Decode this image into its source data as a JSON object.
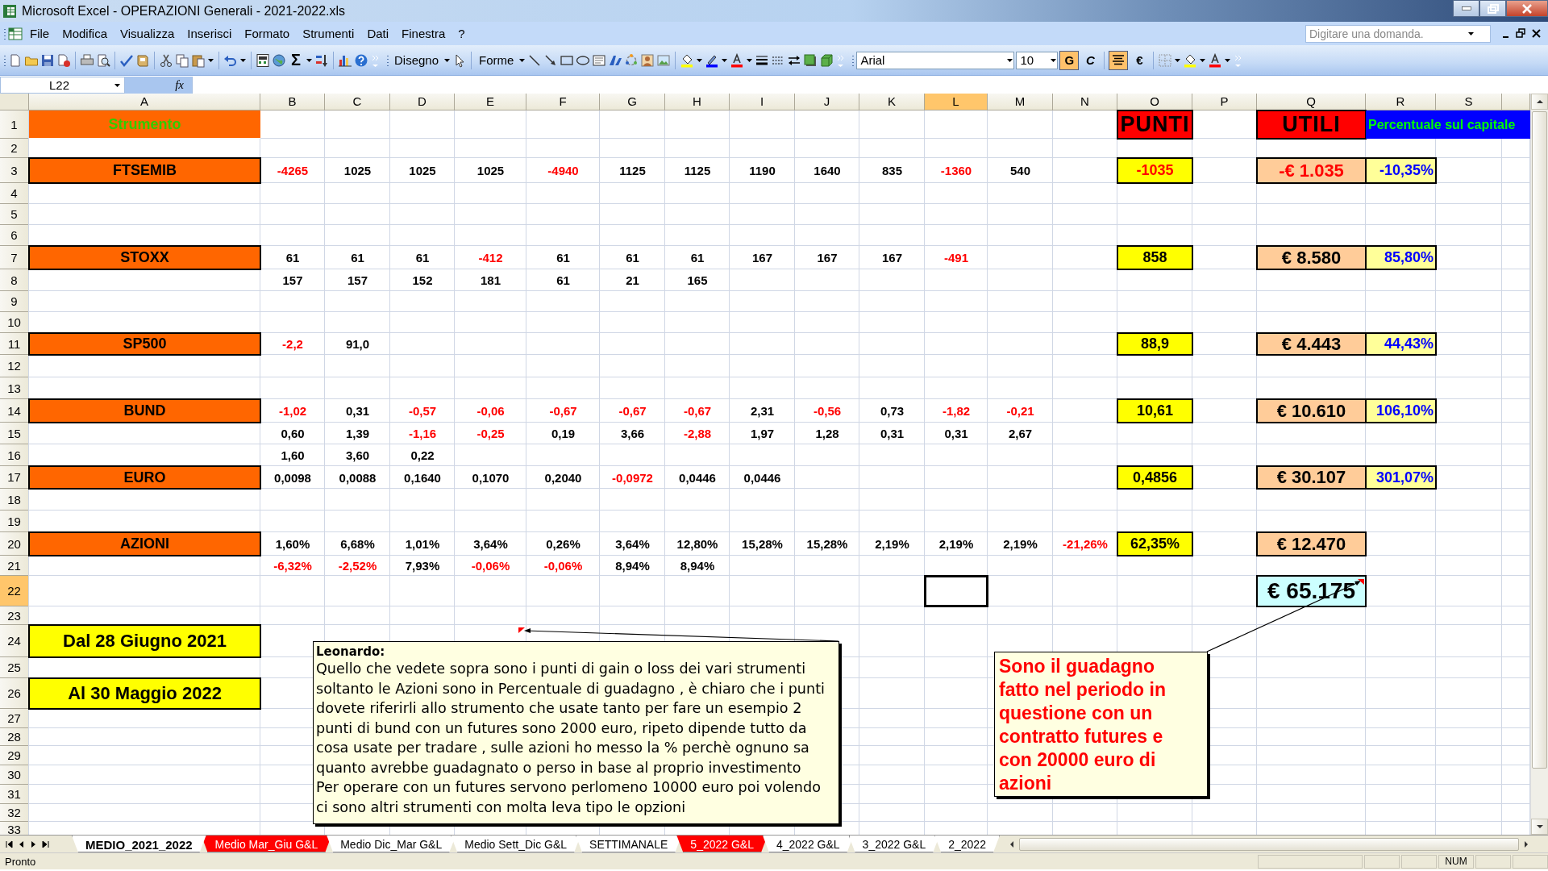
{
  "window": {
    "title": "Microsoft Excel - OPERAZIONI Generali - 2021-2022.xls"
  },
  "menu": [
    {
      "label": "File"
    },
    {
      "label": "Modifica"
    },
    {
      "label": "Visualizza"
    },
    {
      "label": "Inserisci"
    },
    {
      "label": "Formato"
    },
    {
      "label": "Strumenti"
    },
    {
      "label": "Dati"
    },
    {
      "label": "Finestra"
    },
    {
      "label": "?"
    }
  ],
  "help_field": {
    "placeholder": "Digitare una domanda."
  },
  "toolbar": {
    "sum": "Σ",
    "draw_menu": "Disegno",
    "shapes_menu": "Forme",
    "font": "Arial",
    "size": "10",
    "bold": "G",
    "bold_on": true,
    "italic": "C",
    "italic_on": false,
    "center_on": true,
    "euro": "€"
  },
  "formula_bar": {
    "name_box": "L22",
    "fx": "fx"
  },
  "columns": [
    {
      "label": "A",
      "selected": false
    },
    {
      "label": "B",
      "selected": false
    },
    {
      "label": "C",
      "selected": false
    },
    {
      "label": "D",
      "selected": false
    },
    {
      "label": "E",
      "selected": false
    },
    {
      "label": "F",
      "selected": false
    },
    {
      "label": "G",
      "selected": false
    },
    {
      "label": "H",
      "selected": false
    },
    {
      "label": "I",
      "selected": false
    },
    {
      "label": "J",
      "selected": false
    },
    {
      "label": "K",
      "selected": false
    },
    {
      "label": "L",
      "selected": true
    },
    {
      "label": "M",
      "selected": false
    },
    {
      "label": "N",
      "selected": false
    },
    {
      "label": "O",
      "selected": false
    },
    {
      "label": "P",
      "selected": false
    },
    {
      "label": "Q",
      "selected": false
    },
    {
      "label": "R",
      "selected": false
    },
    {
      "label": "S",
      "selected": false
    }
  ],
  "rows": [
    {
      "header": "1",
      "selected": false,
      "cells": {
        "A": {
          "kind": "title",
          "text": "Strumento",
          "negative": false
        },
        "O": {
          "kind": "heading",
          "text": "PUNTI",
          "negative": false
        },
        "Q": {
          "kind": "heading",
          "text": "UTILI",
          "negative": false
        },
        "R": {
          "kind": "banner",
          "text": "Percentuale sul capitale",
          "negative": false
        }
      }
    },
    {
      "header": "2",
      "selected": false,
      "cells": {}
    },
    {
      "header": "3",
      "selected": false,
      "cells": {
        "A": {
          "kind": "label",
          "text": "FTSEMIB",
          "negative": false
        },
        "B": {
          "kind": "value",
          "text": "-4265",
          "negative": true
        },
        "C": {
          "kind": "value",
          "text": "1025",
          "negative": false
        },
        "D": {
          "kind": "value",
          "text": "1025",
          "negative": false
        },
        "E": {
          "kind": "value",
          "text": "1025",
          "negative": false
        },
        "F": {
          "kind": "value",
          "text": "-4940",
          "negative": true
        },
        "G": {
          "kind": "value",
          "text": "1125",
          "negative": false
        },
        "H": {
          "kind": "value",
          "text": "1125",
          "negative": false
        },
        "I": {
          "kind": "value",
          "text": "1190",
          "negative": false
        },
        "J": {
          "kind": "value",
          "text": "1640",
          "negative": false
        },
        "K": {
          "kind": "value",
          "text": "835",
          "negative": false
        },
        "L": {
          "kind": "value",
          "text": "-1360",
          "negative": true
        },
        "M": {
          "kind": "value",
          "text": "540",
          "negative": false
        },
        "O": {
          "kind": "points",
          "text": "-1035",
          "negative": true
        },
        "Q": {
          "kind": "profit",
          "text": "-€ 1.035",
          "negative": true
        },
        "R": {
          "kind": "percent",
          "text": "-10,35%",
          "negative": false
        }
      }
    },
    {
      "header": "4",
      "selected": false,
      "cells": {}
    },
    {
      "header": "5",
      "selected": false,
      "cells": {}
    },
    {
      "header": "6",
      "selected": false,
      "cells": {}
    },
    {
      "header": "7",
      "selected": false,
      "cells": {
        "A": {
          "kind": "label",
          "text": "STOXX",
          "negative": false
        },
        "B": {
          "kind": "value",
          "text": "61",
          "negative": false
        },
        "C": {
          "kind": "value",
          "text": "61",
          "negative": false
        },
        "D": {
          "kind": "value",
          "text": "61",
          "negative": false
        },
        "E": {
          "kind": "value",
          "text": "-412",
          "negative": true
        },
        "F": {
          "kind": "value",
          "text": "61",
          "negative": false
        },
        "G": {
          "kind": "value",
          "text": "61",
          "negative": false
        },
        "H": {
          "kind": "value",
          "text": "61",
          "negative": false
        },
        "I": {
          "kind": "value",
          "text": "167",
          "negative": false
        },
        "J": {
          "kind": "value",
          "text": "167",
          "negative": false
        },
        "K": {
          "kind": "value",
          "text": "167",
          "negative": false
        },
        "L": {
          "kind": "value",
          "text": "-491",
          "negative": true
        },
        "O": {
          "kind": "points",
          "text": "858",
          "negative": false
        },
        "Q": {
          "kind": "profit",
          "text": "€ 8.580",
          "negative": false
        },
        "R": {
          "kind": "percent",
          "text": "85,80%",
          "negative": false
        }
      }
    },
    {
      "header": "8",
      "selected": false,
      "cells": {
        "B": {
          "kind": "value",
          "text": "157",
          "negative": false
        },
        "C": {
          "kind": "value",
          "text": "157",
          "negative": false
        },
        "D": {
          "kind": "value",
          "text": "152",
          "negative": false
        },
        "E": {
          "kind": "value",
          "text": "181",
          "negative": false
        },
        "F": {
          "kind": "value",
          "text": "61",
          "negative": false
        },
        "G": {
          "kind": "value",
          "text": "21",
          "negative": false
        },
        "H": {
          "kind": "value",
          "text": "165",
          "negative": false
        }
      }
    },
    {
      "header": "9",
      "selected": false,
      "cells": {}
    },
    {
      "header": "10",
      "selected": false,
      "cells": {}
    },
    {
      "header": "11",
      "selected": false,
      "cells": {
        "A": {
          "kind": "label",
          "text": "SP500",
          "negative": false
        },
        "B": {
          "kind": "value",
          "text": "-2,2",
          "negative": true
        },
        "C": {
          "kind": "value",
          "text": "91,0",
          "negative": false
        },
        "O": {
          "kind": "points",
          "text": "88,9",
          "negative": false
        },
        "Q": {
          "kind": "profit",
          "text": "€ 4.443",
          "negative": false
        },
        "R": {
          "kind": "percent",
          "text": "44,43%",
          "negative": false
        }
      }
    },
    {
      "header": "12",
      "selected": false,
      "cells": {}
    },
    {
      "header": "13",
      "selected": false,
      "cells": {}
    },
    {
      "header": "14",
      "selected": false,
      "cells": {
        "A": {
          "kind": "label",
          "text": "BUND",
          "negative": false
        },
        "B": {
          "kind": "value",
          "text": "-1,02",
          "negative": true
        },
        "C": {
          "kind": "value",
          "text": "0,31",
          "negative": false
        },
        "D": {
          "kind": "value",
          "text": "-0,57",
          "negative": true
        },
        "E": {
          "kind": "value",
          "text": "-0,06",
          "negative": true
        },
        "F": {
          "kind": "value",
          "text": "-0,67",
          "negative": true
        },
        "G": {
          "kind": "value",
          "text": "-0,67",
          "negative": true
        },
        "H": {
          "kind": "value",
          "text": "-0,67",
          "negative": true
        },
        "I": {
          "kind": "value",
          "text": "2,31",
          "negative": false
        },
        "J": {
          "kind": "value",
          "text": "-0,56",
          "negative": true
        },
        "K": {
          "kind": "value",
          "text": "0,73",
          "negative": false
        },
        "L": {
          "kind": "value",
          "text": "-1,82",
          "negative": true
        },
        "M": {
          "kind": "value",
          "text": "-0,21",
          "negative": true
        },
        "O": {
          "kind": "points",
          "text": "10,61",
          "negative": false
        },
        "Q": {
          "kind": "profit",
          "text": "€ 10.610",
          "negative": false
        },
        "R": {
          "kind": "percent",
          "text": "106,10%",
          "negative": false
        }
      }
    },
    {
      "header": "15",
      "selected": false,
      "cells": {
        "B": {
          "kind": "value",
          "text": "0,60",
          "negative": false
        },
        "C": {
          "kind": "value",
          "text": "1,39",
          "negative": false
        },
        "D": {
          "kind": "value",
          "text": "-1,16",
          "negative": true
        },
        "E": {
          "kind": "value",
          "text": "-0,25",
          "negative": true
        },
        "F": {
          "kind": "value",
          "text": "0,19",
          "negative": false
        },
        "G": {
          "kind": "value",
          "text": "3,66",
          "negative": false
        },
        "H": {
          "kind": "value",
          "text": "-2,88",
          "negative": true
        },
        "I": {
          "kind": "value",
          "text": "1,97",
          "negative": false
        },
        "J": {
          "kind": "value",
          "text": "1,28",
          "negative": false
        },
        "K": {
          "kind": "value",
          "text": "0,31",
          "negative": false
        },
        "L": {
          "kind": "value",
          "text": "0,31",
          "negative": false
        },
        "M": {
          "kind": "value",
          "text": "2,67",
          "negative": false
        }
      }
    },
    {
      "header": "16",
      "selected": false,
      "cells": {
        "B": {
          "kind": "value",
          "text": "1,60",
          "negative": false
        },
        "C": {
          "kind": "value",
          "text": "3,60",
          "negative": false
        },
        "D": {
          "kind": "value",
          "text": "0,22",
          "negative": false
        }
      }
    },
    {
      "header": "17",
      "selected": false,
      "cells": {
        "A": {
          "kind": "label",
          "text": "EURO",
          "negative": false
        },
        "B": {
          "kind": "value",
          "text": "0,0098",
          "negative": false
        },
        "C": {
          "kind": "value",
          "text": "0,0088",
          "negative": false
        },
        "D": {
          "kind": "value",
          "text": "0,1640",
          "negative": false
        },
        "E": {
          "kind": "value",
          "text": "0,1070",
          "negative": false
        },
        "F": {
          "kind": "value",
          "text": "0,2040",
          "negative": false
        },
        "G": {
          "kind": "value",
          "text": "-0,0972",
          "negative": true
        },
        "H": {
          "kind": "value",
          "text": "0,0446",
          "negative": false
        },
        "I": {
          "kind": "value",
          "text": "0,0446",
          "negative": false
        },
        "O": {
          "kind": "points",
          "text": "0,4856",
          "negative": false
        },
        "Q": {
          "kind": "profit",
          "text": "€ 30.107",
          "negative": false
        },
        "R": {
          "kind": "percent",
          "text": "301,07%",
          "negative": false
        }
      }
    },
    {
      "header": "18",
      "selected": false,
      "cells": {}
    },
    {
      "header": "19",
      "selected": false,
      "cells": {}
    },
    {
      "header": "20",
      "selected": false,
      "cells": {
        "A": {
          "kind": "label",
          "text": "AZIONI",
          "negative": false
        },
        "B": {
          "kind": "value",
          "text": "1,60%",
          "negative": false
        },
        "C": {
          "kind": "value",
          "text": "6,68%",
          "negative": false
        },
        "D": {
          "kind": "value",
          "text": "1,01%",
          "negative": false
        },
        "E": {
          "kind": "value",
          "text": "3,64%",
          "negative": false
        },
        "F": {
          "kind": "value",
          "text": "0,26%",
          "negative": false
        },
        "G": {
          "kind": "value",
          "text": "3,64%",
          "negative": false
        },
        "H": {
          "kind": "value",
          "text": "12,80%",
          "negative": false
        },
        "I": {
          "kind": "value",
          "text": "15,28%",
          "negative": false
        },
        "J": {
          "kind": "value",
          "text": "15,28%",
          "negative": false
        },
        "K": {
          "kind": "value",
          "text": "2,19%",
          "negative": false
        },
        "L": {
          "kind": "value",
          "text": "2,19%",
          "negative": false
        },
        "M": {
          "kind": "value",
          "text": "2,19%",
          "negative": false
        },
        "N": {
          "kind": "value",
          "text": "-21,26%",
          "negative": true
        },
        "O": {
          "kind": "points",
          "text": "62,35%",
          "negative": false
        },
        "Q": {
          "kind": "profit",
          "text": "€ 12.470",
          "negative": false
        }
      }
    },
    {
      "header": "21",
      "selected": false,
      "cells": {
        "B": {
          "kind": "value",
          "text": "-6,32%",
          "negative": true
        },
        "C": {
          "kind": "value",
          "text": "-2,52%",
          "negative": true
        },
        "D": {
          "kind": "value",
          "text": "7,93%",
          "negative": false
        },
        "E": {
          "kind": "value",
          "text": "-0,06%",
          "negative": true
        },
        "F": {
          "kind": "value",
          "text": "-0,06%",
          "negative": true
        },
        "G": {
          "kind": "value",
          "text": "8,94%",
          "negative": false
        },
        "H": {
          "kind": "value",
          "text": "8,94%",
          "negative": false
        }
      }
    },
    {
      "header": "22",
      "selected": true,
      "cells": {
        "Q": {
          "kind": "total",
          "text": "€ 65.175",
          "negative": false
        }
      }
    },
    {
      "header": "23",
      "selected": false,
      "cells": {}
    },
    {
      "header": "24",
      "selected": false,
      "cells": {
        "A": {
          "kind": "date",
          "text": "Dal 28 Giugno  2021",
          "negative": false
        }
      }
    },
    {
      "header": "25",
      "selected": false,
      "cells": {}
    },
    {
      "header": "26",
      "selected": false,
      "cells": {
        "A": {
          "kind": "date",
          "text": "Al 30 Maggio 2022",
          "negative": false
        }
      }
    },
    {
      "header": "27",
      "selected": false,
      "cells": {}
    },
    {
      "header": "28",
      "selected": false,
      "cells": {}
    },
    {
      "header": "29",
      "selected": false,
      "cells": {}
    },
    {
      "header": "30",
      "selected": false,
      "cells": {}
    },
    {
      "header": "31",
      "selected": false,
      "cells": {}
    },
    {
      "header": "32",
      "selected": false,
      "cells": {}
    },
    {
      "header": "33",
      "selected": false,
      "cells": {}
    }
  ],
  "comments": [
    {
      "kind": "note",
      "author": "Leonardo:",
      "text": "Quello che vedete sopra sono i punti di gain o loss dei vari strumenti soltanto le Azioni sono in Percentuale di guadagno , è chiaro che i punti dovete riferirli allo strumento che usate tanto per fare un esempio 2 punti di bund con un futures sono 2000 euro, ripeto dipende tutto da cosa usate per tradare , sulle azioni ho messo la % perchè ognuno sa quanto avrebbe guadagnato o perso in base al proprio investimento\nPer operare con un futures servono perlomeno 10000 euro poi volendo ci sono altri strumenti con molta leva tipo le opzioni"
    },
    {
      "kind": "callout",
      "text": "Sono il guadagno fatto nel periodo in questione con un contratto futures e con 20000 euro di azioni"
    }
  ],
  "sheet_tabs": [
    {
      "label": "MEDIO_2021_2022",
      "selected": true
    },
    {
      "label": "Medio Mar_Giu G&L",
      "selected": false,
      "color": "#ff0000"
    },
    {
      "label": "Medio Dic_Mar G&L",
      "selected": false
    },
    {
      "label": "Medio Sett_Dic G&L",
      "selected": false
    },
    {
      "label": "SETTIMANALE",
      "selected": false
    },
    {
      "label": "5_2022 G&L",
      "selected": false,
      "color": "#ff0000"
    },
    {
      "label": "4_2022 G&L",
      "selected": false
    },
    {
      "label": "3_2022 G&L",
      "selected": false
    },
    {
      "label": "2_2022",
      "selected": false
    }
  ],
  "status_bar": {
    "message": "Pronto",
    "indicator": "NUM"
  }
}
